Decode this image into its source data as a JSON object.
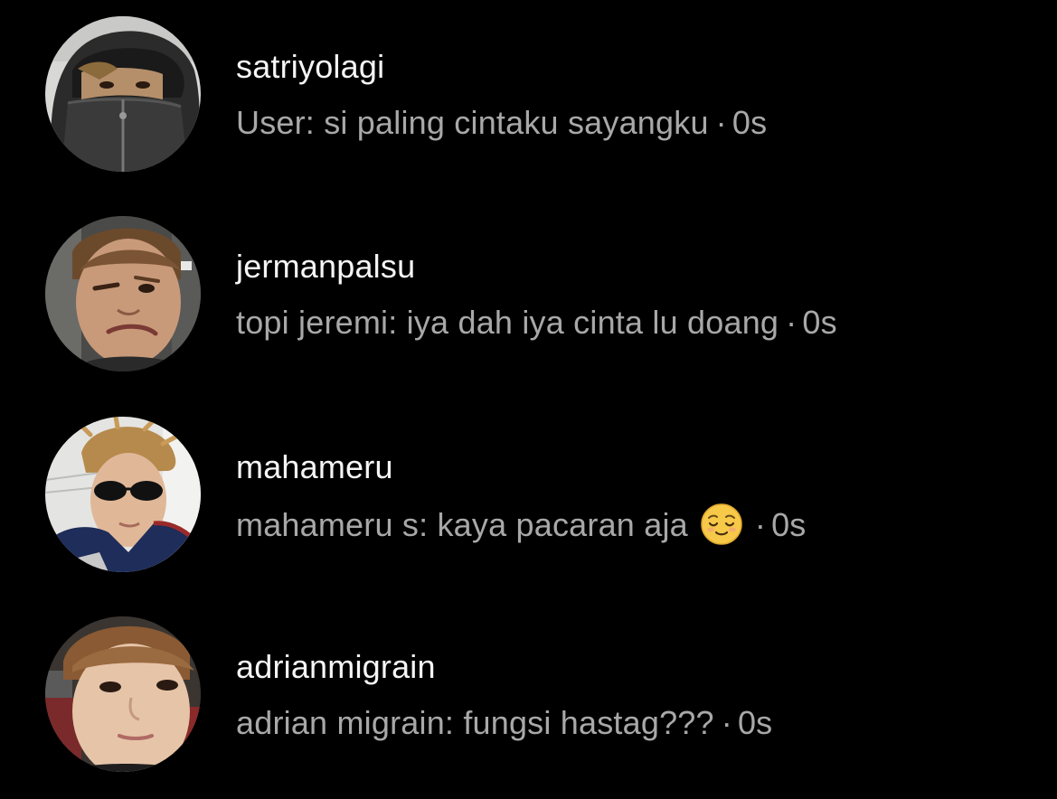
{
  "threads": [
    {
      "username": "satriyolagi",
      "preview": "User: si paling cintaku sayangku",
      "separator": "·",
      "time": "0s",
      "avatar_icon": "avatar-hooded-person"
    },
    {
      "username": "jermanpalsu",
      "preview": "topi jeremi: iya dah iya cinta lu doang",
      "separator": "·",
      "time": "0s",
      "avatar_icon": "avatar-squinting-face"
    },
    {
      "username": "mahameru",
      "preview": "mahameru s: kaya pacaran aja",
      "emoji": "relieved-face-emoji",
      "separator": "·",
      "time": "0s",
      "avatar_icon": "avatar-sunglasses-person"
    },
    {
      "username": "adrianmigrain",
      "preview": "adrian migrain: fungsi hastag???",
      "separator": "·",
      "time": "0s",
      "avatar_icon": "avatar-closeup-face"
    }
  ],
  "colors": {
    "background": "#000000",
    "username": "#f5f5f5",
    "preview": "#a8a8a8"
  }
}
